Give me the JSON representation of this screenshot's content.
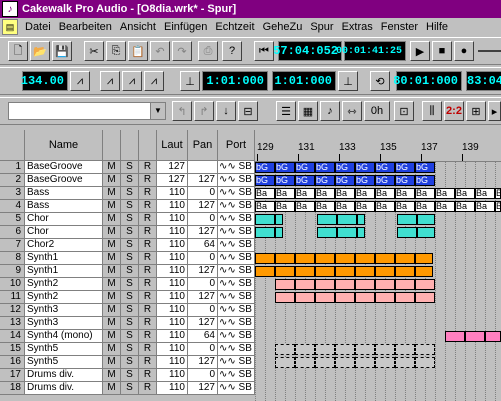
{
  "window": {
    "title": "Cakewalk Pro Audio - [O8dia.wrk* - Spur]"
  },
  "menu": [
    "Datei",
    "Bearbeiten",
    "Ansicht",
    "Einfügen",
    "Echtzeit",
    "GeheZu",
    "Spur",
    "Extras",
    "Fenster",
    "Hilfe"
  ],
  "transport": {
    "time_mbt": "57:04:052",
    "time_smpte": "00:01:41:25"
  },
  "tempo": "134.00",
  "markers": {
    "from": "1:01:000",
    "to": "1:01:000",
    "loop_start": "80:01:000",
    "loop_end": "83:04"
  },
  "columns": {
    "name": "Name",
    "m": "M",
    "s": "S",
    "r": "R",
    "vol": "Laut",
    "pan": "Pan",
    "port": "Port"
  },
  "tracks": [
    {
      "n": "1",
      "name": "BaseGroove",
      "vol": "127",
      "pan": "",
      "port": "∿∿ SB"
    },
    {
      "n": "2",
      "name": "BaseGroove",
      "vol": "127",
      "pan": "127",
      "port": "∿∿ SB"
    },
    {
      "n": "3",
      "name": "Bass",
      "vol": "110",
      "pan": "0",
      "port": "∿∿ SB"
    },
    {
      "n": "4",
      "name": "Bass",
      "vol": "110",
      "pan": "127",
      "port": "∿∿ SB"
    },
    {
      "n": "5",
      "name": "Chor",
      "vol": "110",
      "pan": "0",
      "port": "∿∿ SB"
    },
    {
      "n": "6",
      "name": "Chor",
      "vol": "110",
      "pan": "127",
      "port": "∿∿ SB"
    },
    {
      "n": "7",
      "name": "Chor2",
      "vol": "110",
      "pan": "64",
      "port": "∿∿ SB"
    },
    {
      "n": "8",
      "name": "Synth1",
      "vol": "110",
      "pan": "0",
      "port": "∿∿ SB"
    },
    {
      "n": "9",
      "name": "Synth1",
      "vol": "110",
      "pan": "127",
      "port": "∿∿ SB"
    },
    {
      "n": "10",
      "name": "Synth2",
      "vol": "110",
      "pan": "0",
      "port": "∿∿ SB"
    },
    {
      "n": "11",
      "name": "Synth2",
      "vol": "110",
      "pan": "127",
      "port": "∿∿ SB"
    },
    {
      "n": "12",
      "name": "Synth3",
      "vol": "110",
      "pan": "0",
      "port": "∿∿ SB"
    },
    {
      "n": "13",
      "name": "Synth3",
      "vol": "110",
      "pan": "127",
      "port": "∿∿ SB"
    },
    {
      "n": "14",
      "name": "Synth4 (mono)",
      "vol": "110",
      "pan": "64",
      "port": "∿∿ SB"
    },
    {
      "n": "15",
      "name": "Synth5",
      "vol": "110",
      "pan": "0",
      "port": "∿∿ SB"
    },
    {
      "n": "16",
      "name": "Synth5",
      "vol": "110",
      "pan": "127",
      "port": "∿∿ SB"
    },
    {
      "n": "17",
      "name": "Drums div.",
      "vol": "110",
      "pan": "0",
      "port": "∿∿ SB"
    },
    {
      "n": "18",
      "name": "Drums div.",
      "vol": "110",
      "pan": "127",
      "port": "∿∿ SB"
    }
  ],
  "ruler": [
    "129",
    "131",
    "133",
    "135",
    "137",
    "139"
  ],
  "clip_labels": {
    "groove": "bG",
    "bass": "Ba",
    "chor": "",
    "synth": ""
  },
  "colors": {
    "title_bg": "#800080",
    "lcd_fg": "#00ffff",
    "groove": "#2040e0",
    "bass": "#ffffff",
    "chor": "#40e0d0",
    "synth1": "#ff9900",
    "synth2": "#ffb0b0",
    "synth4": "#ff80c0",
    "synth5": "#c8c8c8"
  }
}
